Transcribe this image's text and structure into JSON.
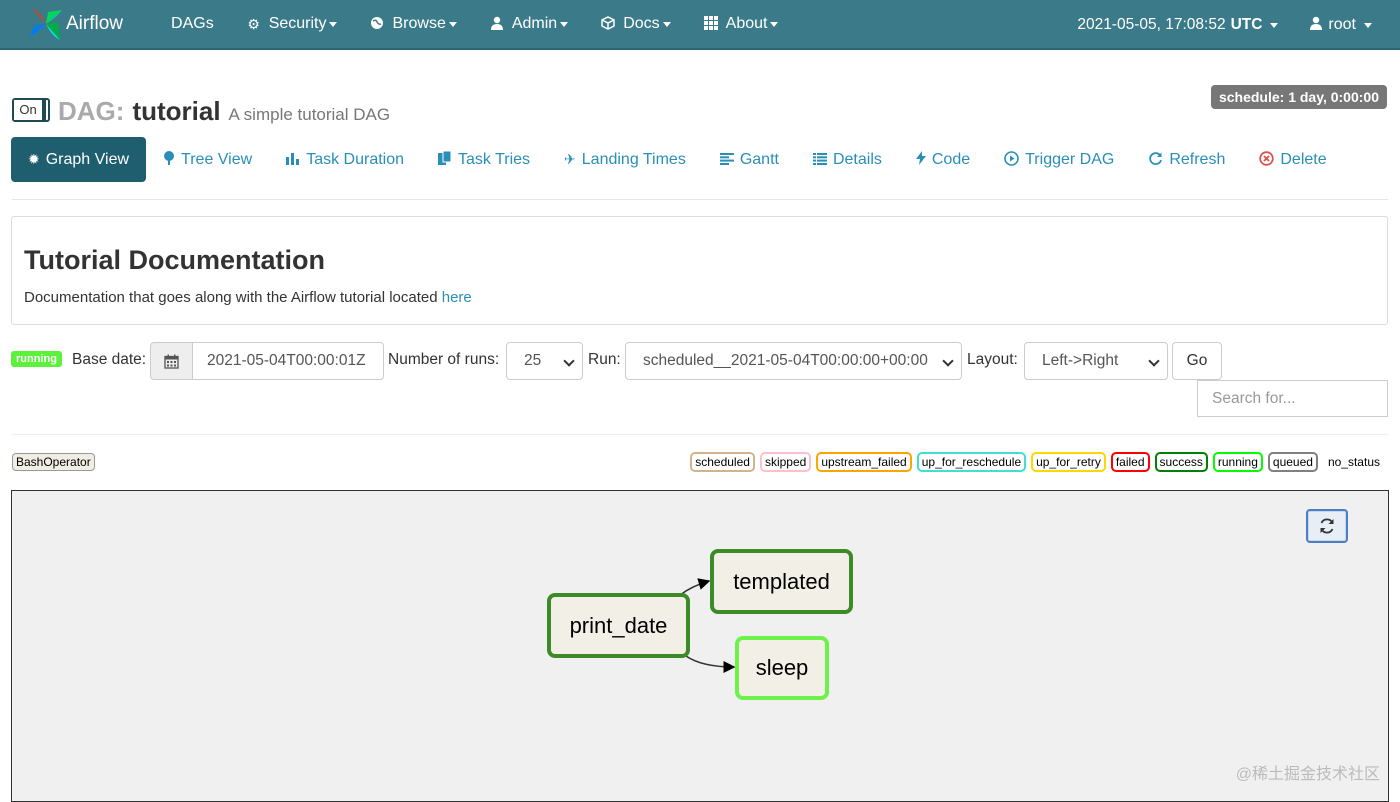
{
  "navbar": {
    "brand": "Airflow",
    "items": [
      {
        "label": "DAGs",
        "icon": "none"
      },
      {
        "label": "Security",
        "icon": "cogs-icon"
      },
      {
        "label": "Browse",
        "icon": "globe-icon"
      },
      {
        "label": "Admin",
        "icon": "user-icon"
      },
      {
        "label": "Docs",
        "icon": "cube-icon"
      },
      {
        "label": "About",
        "icon": "grid-icon"
      }
    ],
    "datetime": "2021-05-05, 17:08:52",
    "timezone": "UTC",
    "user": "root"
  },
  "dag": {
    "toggle_label": "On",
    "prefix": "DAG:",
    "name": "tutorial",
    "description": "A simple tutorial DAG",
    "schedule": "schedule: 1 day, 0:00:00"
  },
  "tabs": [
    {
      "label": "Graph View",
      "icon": "sun-icon",
      "active": true
    },
    {
      "label": "Tree View",
      "icon": "tree-icon"
    },
    {
      "label": "Task Duration",
      "icon": "bar-chart-icon"
    },
    {
      "label": "Task Tries",
      "icon": "files-icon"
    },
    {
      "label": "Landing Times",
      "icon": "plane-icon"
    },
    {
      "label": "Gantt",
      "icon": "align-left-icon"
    },
    {
      "label": "Details",
      "icon": "list-icon"
    },
    {
      "label": "Code",
      "icon": "flash-icon"
    },
    {
      "label": "Trigger DAG",
      "icon": "play-circle-icon"
    },
    {
      "label": "Refresh",
      "icon": "refresh-icon"
    },
    {
      "label": "Delete",
      "icon": "remove-circle-icon"
    }
  ],
  "doc": {
    "title": "Tutorial Documentation",
    "text": "Documentation that goes along with the Airflow tutorial located",
    "link": "here"
  },
  "form": {
    "state_badge": "running",
    "base_date_label": "Base date:",
    "base_date_value": "2021-05-04T00:00:01Z",
    "num_runs_label": "Number of runs:",
    "num_runs_value": "25",
    "run_label": "Run:",
    "run_value": "scheduled__2021-05-04T00:00:00+00:00",
    "layout_label": "Layout:",
    "layout_value": "Left->Right",
    "go_label": "Go",
    "search_placeholder": "Search for..."
  },
  "operator_badge": "BashOperator",
  "legend": [
    {
      "label": "scheduled",
      "color": "#d2b48c"
    },
    {
      "label": "skipped",
      "color": "#ffc0cb"
    },
    {
      "label": "upstream_failed",
      "color": "#ffa500"
    },
    {
      "label": "up_for_reschedule",
      "color": "#40e0d0"
    },
    {
      "label": "up_for_retry",
      "color": "#ffd700"
    },
    {
      "label": "failed",
      "color": "#ff0000"
    },
    {
      "label": "success",
      "color": "#008000"
    },
    {
      "label": "running",
      "color": "#00ff00"
    },
    {
      "label": "queued",
      "color": "#808080"
    }
  ],
  "legend_no_status": "no_status",
  "graph": {
    "nodes": [
      {
        "label": "print_date",
        "state": "success",
        "color": "#3c8b27"
      },
      {
        "label": "templated",
        "state": "success",
        "color": "#3c8b27"
      },
      {
        "label": "sleep",
        "state": "running",
        "color": "#6ef14a"
      }
    ]
  },
  "watermark": "@稀土掘金技术社区"
}
